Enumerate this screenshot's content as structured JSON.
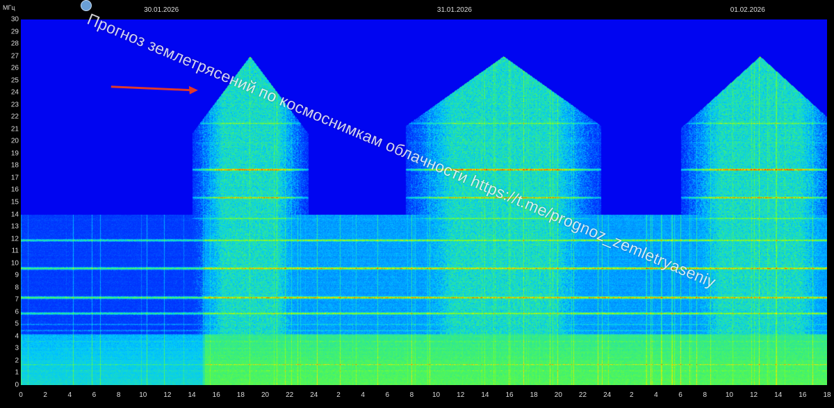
{
  "watermark": {
    "text": "Прогноз землетрясений по космоснимкам облачности  https://t.me/prognoz_zemletryaseniy",
    "icon": "telegram-dot-icon"
  },
  "colors": {
    "background": "#0000f0",
    "low": "#0032ff",
    "mid": "#00c8ff",
    "high": "#50ff50",
    "peak": "#ffdc00",
    "max": "#ff3000",
    "arrow": "#e03a2a"
  },
  "chart_data": {
    "type": "heatmap",
    "title": "",
    "y_unit_label": "МГц",
    "ylabel": "",
    "xlabel": "",
    "ylim": [
      0,
      30
    ],
    "y_ticks": [
      "0",
      "1",
      "2",
      "3",
      "4",
      "5",
      "6",
      "7",
      "8",
      "9",
      "10",
      "11",
      "12",
      "13",
      "14",
      "15",
      "16",
      "17",
      "18",
      "19",
      "20",
      "21",
      "22",
      "23",
      "24",
      "25",
      "26",
      "27",
      "28",
      "29",
      "30"
    ],
    "x_ticks": [
      "0",
      "2",
      "4",
      "6",
      "8",
      "10",
      "12",
      "14",
      "16",
      "18",
      "20",
      "22",
      "24",
      "2",
      "4",
      "6",
      "8",
      "10",
      "12",
      "14",
      "16",
      "18",
      "20",
      "22",
      "24",
      "2",
      "4",
      "6",
      "8",
      "10",
      "12",
      "14",
      "16",
      "18"
    ],
    "date_labels": [
      "30.01.2026",
      "31.01.2026",
      "01.02.2026"
    ],
    "x_range_hours": [
      0,
      66
    ],
    "date_label_hours": [
      11.5,
      35.5,
      59.5
    ],
    "grid": false,
    "legend": "none",
    "activity_windows_hours": [
      [
        15,
        22.5
      ],
      [
        32.5,
        46.5
      ],
      [
        55,
        66
      ]
    ],
    "bands": [
      {
        "freq_mhz": 0.6,
        "intensity": "high"
      },
      {
        "freq_mhz": 1.2,
        "intensity": "high"
      },
      {
        "freq_mhz": 1.7,
        "intensity": "peak"
      },
      {
        "freq_mhz": 2.3,
        "intensity": "high"
      },
      {
        "freq_mhz": 3.0,
        "intensity": "high"
      },
      {
        "freq_mhz": 3.6,
        "intensity": "high"
      },
      {
        "freq_mhz": 4.5,
        "intensity": "mid"
      },
      {
        "freq_mhz": 5.0,
        "intensity": "mid"
      },
      {
        "freq_mhz": 5.9,
        "intensity": "peak"
      },
      {
        "freq_mhz": 7.2,
        "intensity": "max"
      },
      {
        "freq_mhz": 9.6,
        "intensity": "max"
      },
      {
        "freq_mhz": 11.9,
        "intensity": "peak"
      },
      {
        "freq_mhz": 13.7,
        "intensity": "high"
      },
      {
        "freq_mhz": 15.4,
        "intensity": "peak"
      },
      {
        "freq_mhz": 17.7,
        "intensity": "max"
      },
      {
        "freq_mhz": 19.9,
        "intensity": "mid"
      },
      {
        "freq_mhz": 21.5,
        "intensity": "high"
      },
      {
        "freq_mhz": 23.1,
        "intensity": "mid"
      },
      {
        "freq_mhz": 26.9,
        "intensity": "high"
      },
      {
        "freq_mhz": 28.6,
        "intensity": "mid"
      }
    ],
    "annotations": [
      {
        "type": "arrow",
        "points_to_hour": 14.5,
        "points_to_freq_mhz": 24.2
      }
    ]
  }
}
